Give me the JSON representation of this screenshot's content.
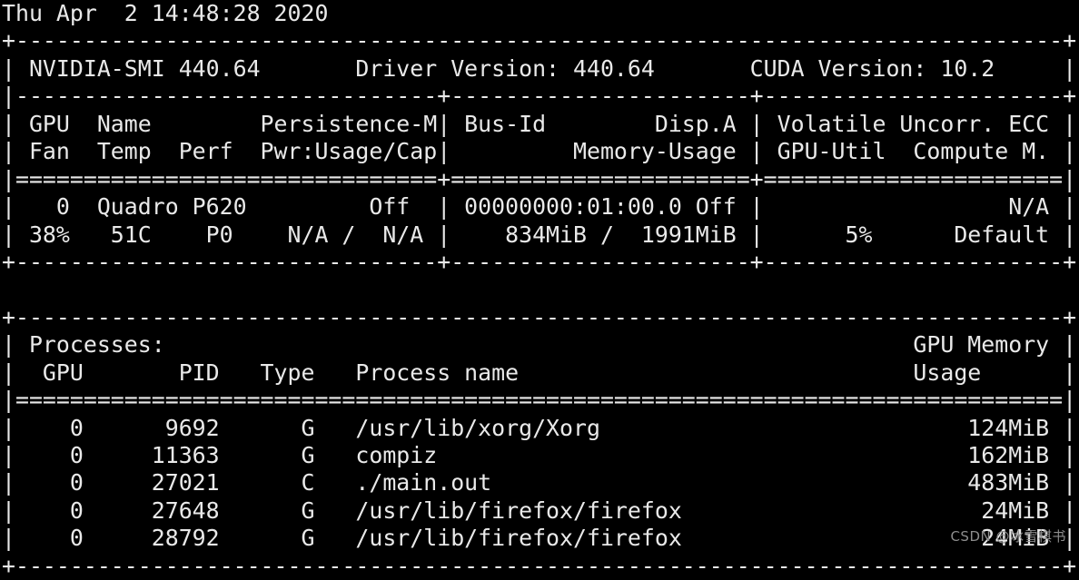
{
  "terminal": {
    "type": "nvidia-smi output",
    "background_color": "#000000",
    "text_color": "#e9e9e9",
    "timestamp_line": "Thu Apr  2 14:48:28 2020",
    "watermark": "CSDN @冰雪棋书"
  },
  "smi_header": {
    "tool_version_label": "NVIDIA-SMI 440.64",
    "driver_version_label": "Driver Version: 440.64",
    "cuda_version_label": "CUDA Version: 10.2"
  },
  "gpu_table": {
    "header_row_1": [
      "GPU",
      "Name",
      "Persistence-M",
      "Bus-Id",
      "Disp.A",
      "Volatile Uncorr. ECC"
    ],
    "header_row_2": [
      "Fan",
      "Temp",
      "Perf",
      "Pwr:Usage/Cap",
      "Memory-Usage",
      "GPU-Util",
      "Compute M."
    ],
    "gpus": [
      {
        "index": "0",
        "name": "Quadro P620",
        "persistence_mode": "Off",
        "bus_id": "00000000:01:00.0",
        "display_active": "Off",
        "ecc_uncorr": "N/A",
        "fan": "38%",
        "temp": "51C",
        "perf": "P0",
        "pwr_usage_cap": "N/A / N/A",
        "memory_used": "834MiB",
        "memory_total": "1991MiB",
        "gpu_util": "5%",
        "compute_mode": "Default"
      }
    ]
  },
  "process_table": {
    "section_title": "Processes:",
    "columns": [
      "GPU",
      "PID",
      "Type",
      "Process name",
      "GPU Memory"
    ],
    "columns_second_line": [
      "Usage"
    ],
    "rows": [
      {
        "gpu": "0",
        "pid": "9692",
        "type": "G",
        "process_name": "/usr/lib/xorg/Xorg",
        "memory": "124MiB"
      },
      {
        "gpu": "0",
        "pid": "11363",
        "type": "G",
        "process_name": "compiz",
        "memory": "162MiB"
      },
      {
        "gpu": "0",
        "pid": "27021",
        "type": "C",
        "process_name": "./main.out",
        "memory": "483MiB"
      },
      {
        "gpu": "0",
        "pid": "27648",
        "type": "G",
        "process_name": "/usr/lib/firefox/firefox",
        "memory": "24MiB"
      },
      {
        "gpu": "0",
        "pid": "28792",
        "type": "G",
        "process_name": "/usr/lib/firefox/firefox",
        "memory": "24MiB"
      }
    ]
  },
  "rendered_lines": [
    "Thu Apr  2 14:48:28 2020",
    "+-----------------------------------------------------------------------------+",
    "| NVIDIA-SMI 440.64       Driver Version: 440.64       CUDA Version: 10.2     |",
    "|-------------------------------+----------------------+----------------------+",
    "| GPU  Name        Persistence-M| Bus-Id        Disp.A | Volatile Uncorr. ECC |",
    "| Fan  Temp  Perf  Pwr:Usage/Cap|         Memory-Usage | GPU-Util  Compute M. |",
    "|===============================+======================+======================|",
    "|   0  Quadro P620         Off  | 00000000:01:00.0 Off |                  N/A |",
    "| 38%   51C    P0    N/A /  N/A |    834MiB /  1991MiB |      5%      Default |",
    "+-------------------------------+----------------------+----------------------+",
    "",
    "+-----------------------------------------------------------------------------+",
    "| Processes:                                                       GPU Memory |",
    "|  GPU       PID   Type   Process name                             Usage      |",
    "|=============================================================================|",
    "|    0      9692      G   /usr/lib/xorg/Xorg                           124MiB |",
    "|    0     11363      G   compiz                                       162MiB |",
    "|    0     27021      C   ./main.out                                   483MiB |",
    "|    0     27648      G   /usr/lib/firefox/firefox                      24MiB |",
    "|    0     28792      G   /usr/lib/firefox/firefox                      24MiB |",
    "+-----------------------------------------------------------------------------+"
  ]
}
